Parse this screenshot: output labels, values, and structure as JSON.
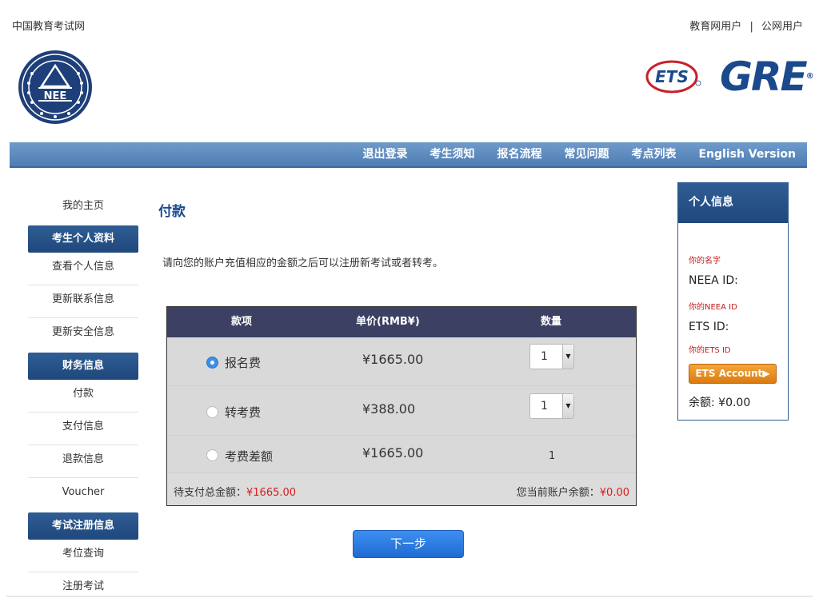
{
  "header": {
    "site_name": "中国教育考试网",
    "link_edu": "教育网用户",
    "separator": "|",
    "link_public": "公网用户",
    "logo_neea_text": "NEE",
    "logo_ets_text": "ETS",
    "logo_gre_text": "GRE"
  },
  "nav": {
    "items": [
      "退出登录",
      "考生须知",
      "报名流程",
      "常见问题",
      "考点列表",
      "English Version"
    ]
  },
  "sidebar": {
    "home": "我的主页",
    "section1": "考生个人资料",
    "s1_items": [
      "查看个人信息",
      "更新联系信息",
      "更新安全信息"
    ],
    "section2": "财务信息",
    "s2_items": [
      "付款",
      "支付信息",
      "退款信息",
      "Voucher"
    ],
    "section3": "考试注册信息",
    "s3_items": [
      "考位查询",
      "注册考试"
    ]
  },
  "main": {
    "title": "付款",
    "description": "请向您的账户充值相应的金额之后可以注册新考试或者转考。",
    "table": {
      "headers": [
        "款项",
        "单价(RMB¥)",
        "数量"
      ],
      "rows": [
        {
          "name": "报名费",
          "price": "¥1665.00",
          "qty": "1",
          "selected": true
        },
        {
          "name": "转考费",
          "price": "¥388.00",
          "qty": "1",
          "selected": false
        },
        {
          "name": "考费差额",
          "price": "¥1665.00",
          "qty": "1",
          "selected": false
        }
      ],
      "total_label": "待支付总金额：",
      "total_value": "¥1665.00",
      "balance_label": "您当前账户余额：",
      "balance_value": "¥0.00"
    },
    "next_button": "下一步"
  },
  "info_panel": {
    "title": "个人信息",
    "name_label": "你的名字",
    "neea_label": "NEEA ID:",
    "neea_value": "你的NEEA ID",
    "ets_label": "ETS ID:",
    "ets_value": "你的ETS ID",
    "ets_button": "ETS Account",
    "balance": "余额: ¥0.00"
  },
  "colors": {
    "nav_blue": "#5a88bd",
    "dark_blue": "#1f487c",
    "table_head": "#3c4062",
    "accent_red": "#d81e1e",
    "orange": "#e08a1e",
    "button_blue": "#2f7be0"
  }
}
